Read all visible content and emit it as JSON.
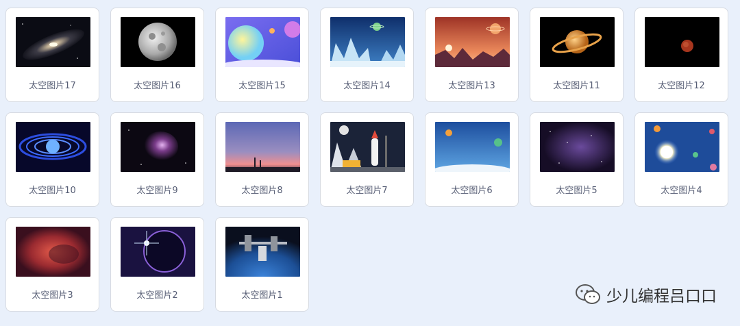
{
  "sprites": [
    {
      "label": "太空图片17",
      "icon": "galaxy-icon"
    },
    {
      "label": "太空图片16",
      "icon": "moon-icon"
    },
    {
      "label": "太空图片15",
      "icon": "cartoon-planets-icon"
    },
    {
      "label": "太空图片14",
      "icon": "ice-crystal-planet-icon"
    },
    {
      "label": "太空图片13",
      "icon": "red-alien-landscape-icon"
    },
    {
      "label": "太空图片11",
      "icon": "saturn-icon"
    },
    {
      "label": "太空图片12",
      "icon": "mars-icon"
    },
    {
      "label": "太空图片10",
      "icon": "blue-vortex-icon"
    },
    {
      "label": "太空图片9",
      "icon": "nebula-icon"
    },
    {
      "label": "太空图片8",
      "icon": "sunset-sky-icon"
    },
    {
      "label": "太空图片7",
      "icon": "rocket-launch-icon"
    },
    {
      "label": "太空图片6",
      "icon": "space-landscape-icon"
    },
    {
      "label": "太空图片5",
      "icon": "purple-starfield-icon"
    },
    {
      "label": "太空图片4",
      "icon": "solar-system-icon"
    },
    {
      "label": "太空图片3",
      "icon": "red-nebula-icon"
    },
    {
      "label": "太空图片2",
      "icon": "eclipse-icon"
    },
    {
      "label": "太空图片1",
      "icon": "space-station-icon"
    }
  ],
  "watermark": {
    "text": "少儿编程吕口口",
    "icon": "wechat-icon"
  }
}
